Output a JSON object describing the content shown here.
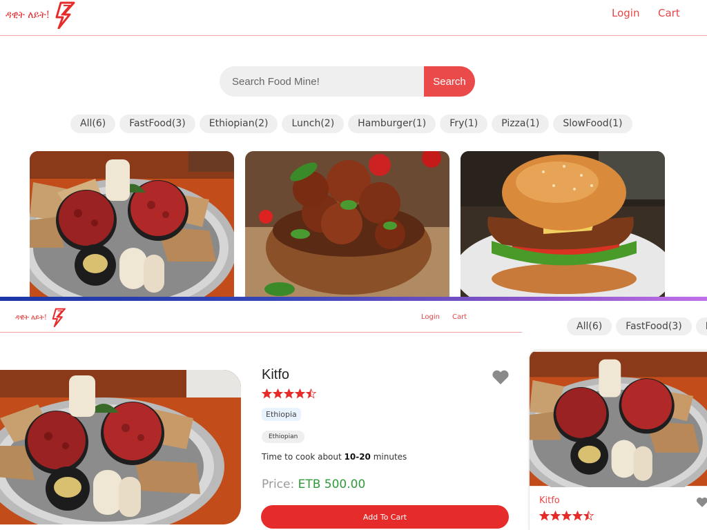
{
  "app": {
    "brand_text": "ዳዊት ለይት!",
    "logo_icon": "lightning-bolt-icon",
    "accent_color": "#e62b2b"
  },
  "top_screen": {
    "nav": {
      "login": "Login",
      "cart": "Cart"
    },
    "search": {
      "placeholder": "Search Food Mine!",
      "button_label": "Search"
    },
    "tags": [
      "All(6)",
      "FastFood(3)",
      "Ethiopian(2)",
      "Lunch(2)",
      "Hamburger(1)",
      "Fry(1)",
      "Pizza(1)",
      "SlowFood(1)"
    ],
    "cards": [
      {
        "image": "kitfo-platter-photo"
      },
      {
        "image": "meatballs-bowl-photo"
      },
      {
        "image": "burger-photo"
      }
    ]
  },
  "bottom_screen": {
    "nav": {
      "login": "Login",
      "cart": "Cart"
    },
    "detail": {
      "name": "Kitfo",
      "rating": 4.5,
      "origin": "Ethiopia",
      "tag": "Ethiopian",
      "cook_prefix": "Time to cook about ",
      "cook_time": "10-20",
      "cook_suffix": " minutes",
      "price_label": "Price:",
      "price_value": "ETB 500.00",
      "add_to_cart": "Add To Cart",
      "favorite_icon": "heart-icon"
    },
    "tags": [
      "All(6)",
      "FastFood(3)",
      "Eth"
    ],
    "side_card": {
      "name": "Kitfo",
      "rating": 4.5,
      "time_icon": "clock-icon"
    }
  }
}
